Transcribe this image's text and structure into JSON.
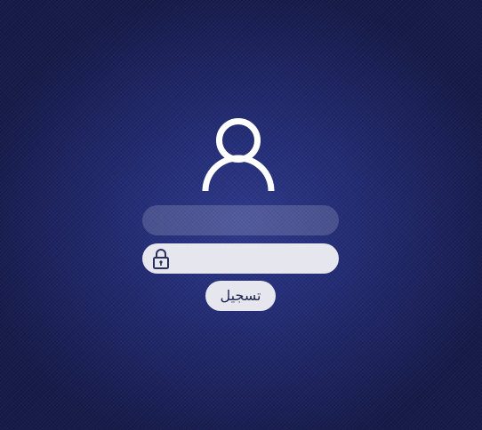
{
  "login": {
    "username": {
      "value": "",
      "placeholder": ""
    },
    "password": {
      "value": "",
      "placeholder": ""
    },
    "submit_label": "تسجيل"
  },
  "icons": {
    "avatar": "user-icon",
    "password": "lock-icon"
  },
  "colors": {
    "background_center": "#2e3a8c",
    "background_edge": "#161b4a",
    "field_light": "#e6e6ee",
    "icon_white": "#ffffff"
  }
}
